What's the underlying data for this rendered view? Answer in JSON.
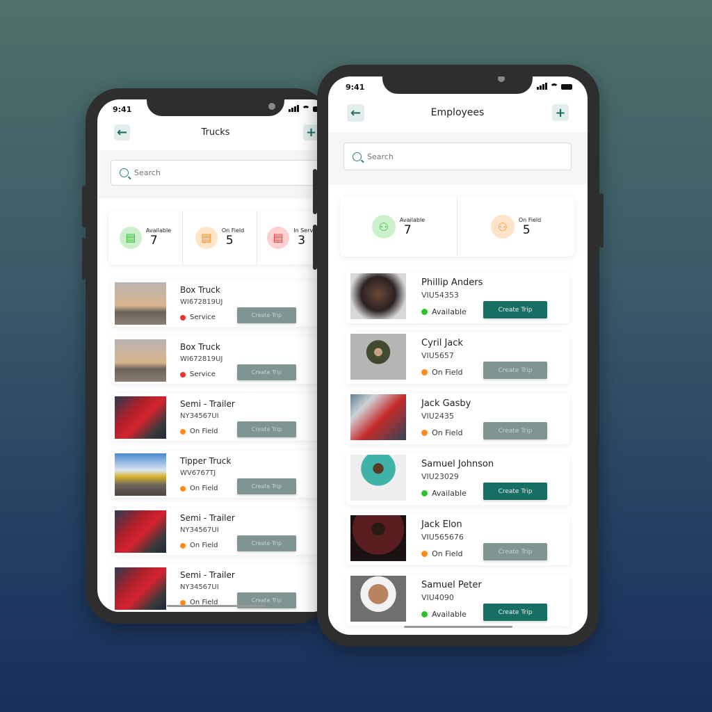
{
  "status_time": "9:41",
  "colors": {
    "accent": "#176e63",
    "available": "#2ec12e",
    "on_field": "#ff8c1a",
    "service": "#ee3333"
  },
  "trucks": {
    "title": "Trucks",
    "back_icon": "arrow-left-icon",
    "add_icon": "plus-icon",
    "search_placeholder": "Search",
    "stats": [
      {
        "label": "Available",
        "value": "7",
        "color": "#2ec12e",
        "bg": "#ccf0cc"
      },
      {
        "label": "On Field",
        "value": "5",
        "color": "#ff8c1a",
        "bg": "#ffe3c8"
      },
      {
        "label": "In Service",
        "value": "3",
        "color": "#ee3a3a",
        "bg": "#ffd0d0"
      }
    ],
    "items": [
      {
        "name": "Box Truck",
        "code": "WI672819UJ",
        "status": "Service",
        "kind": "service",
        "button": "Create Trip",
        "enabled": false
      },
      {
        "name": "Box Truck",
        "code": "WI672819UJ",
        "status": "Service",
        "kind": "service",
        "button": "Create Trip",
        "enabled": false
      },
      {
        "name": "Semi - Trailer",
        "code": "NY34567UI",
        "status": "On Field",
        "kind": "on_field",
        "button": "Create Trip",
        "enabled": false
      },
      {
        "name": "Tipper Truck",
        "code": "WV6767TJ",
        "status": "On Field",
        "kind": "on_field",
        "button": "Create Trip",
        "enabled": false
      },
      {
        "name": "Semi - Trailer",
        "code": "NY34567UI",
        "status": "On Field",
        "kind": "on_field",
        "button": "Create Trip",
        "enabled": false
      },
      {
        "name": "Semi - Trailer",
        "code": "NY34567UI",
        "status": "On Field",
        "kind": "on_field",
        "button": "Create Trip",
        "enabled": false
      }
    ]
  },
  "employees": {
    "title": "Employees",
    "back_icon": "arrow-left-icon",
    "add_icon": "plus-icon",
    "search_placeholder": "Search",
    "stats": [
      {
        "label": "Available",
        "value": "7",
        "color": "#2ec12e",
        "bg": "#ccf0cc"
      },
      {
        "label": "On Field",
        "value": "5",
        "color": "#ff8c1a",
        "bg": "#ffe3c8"
      }
    ],
    "items": [
      {
        "name": "Phillip Anders",
        "code": "VIU54353",
        "status": "Available",
        "kind": "available",
        "button": "Create Trip",
        "enabled": true
      },
      {
        "name": "Cyril Jack",
        "code": "VIU5657",
        "status": "On Field",
        "kind": "on_field",
        "button": "Create Trip",
        "enabled": false
      },
      {
        "name": "Jack Gasby",
        "code": "VIU2435",
        "status": "On Field",
        "kind": "on_field",
        "button": "Create Trip",
        "enabled": false
      },
      {
        "name": "Samuel Johnson",
        "code": "VIU23029",
        "status": "Available",
        "kind": "available",
        "button": "Create Trip",
        "enabled": true
      },
      {
        "name": "Jack Elon",
        "code": "VIU565676",
        "status": "On Field",
        "kind": "on_field",
        "button": "Create Trip",
        "enabled": false
      },
      {
        "name": "Samuel Peter",
        "code": "VIU4090",
        "status": "Available",
        "kind": "available",
        "button": "Create Trip",
        "enabled": true
      }
    ]
  }
}
